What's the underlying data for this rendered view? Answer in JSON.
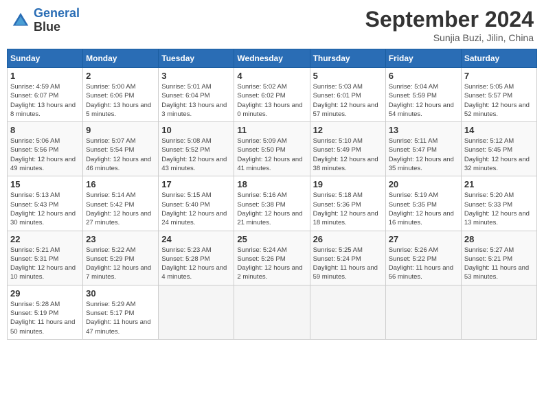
{
  "header": {
    "logo_line1": "General",
    "logo_line2": "Blue",
    "month": "September 2024",
    "location": "Sunjia Buzi, Jilin, China"
  },
  "weekdays": [
    "Sunday",
    "Monday",
    "Tuesday",
    "Wednesday",
    "Thursday",
    "Friday",
    "Saturday"
  ],
  "weeks": [
    [
      {
        "day": "1",
        "sunrise": "Sunrise: 4:59 AM",
        "sunset": "Sunset: 6:07 PM",
        "daylight": "Daylight: 13 hours and 8 minutes."
      },
      {
        "day": "2",
        "sunrise": "Sunrise: 5:00 AM",
        "sunset": "Sunset: 6:06 PM",
        "daylight": "Daylight: 13 hours and 5 minutes."
      },
      {
        "day": "3",
        "sunrise": "Sunrise: 5:01 AM",
        "sunset": "Sunset: 6:04 PM",
        "daylight": "Daylight: 13 hours and 3 minutes."
      },
      {
        "day": "4",
        "sunrise": "Sunrise: 5:02 AM",
        "sunset": "Sunset: 6:02 PM",
        "daylight": "Daylight: 13 hours and 0 minutes."
      },
      {
        "day": "5",
        "sunrise": "Sunrise: 5:03 AM",
        "sunset": "Sunset: 6:01 PM",
        "daylight": "Daylight: 12 hours and 57 minutes."
      },
      {
        "day": "6",
        "sunrise": "Sunrise: 5:04 AM",
        "sunset": "Sunset: 5:59 PM",
        "daylight": "Daylight: 12 hours and 54 minutes."
      },
      {
        "day": "7",
        "sunrise": "Sunrise: 5:05 AM",
        "sunset": "Sunset: 5:57 PM",
        "daylight": "Daylight: 12 hours and 52 minutes."
      }
    ],
    [
      {
        "day": "8",
        "sunrise": "Sunrise: 5:06 AM",
        "sunset": "Sunset: 5:56 PM",
        "daylight": "Daylight: 12 hours and 49 minutes."
      },
      {
        "day": "9",
        "sunrise": "Sunrise: 5:07 AM",
        "sunset": "Sunset: 5:54 PM",
        "daylight": "Daylight: 12 hours and 46 minutes."
      },
      {
        "day": "10",
        "sunrise": "Sunrise: 5:08 AM",
        "sunset": "Sunset: 5:52 PM",
        "daylight": "Daylight: 12 hours and 43 minutes."
      },
      {
        "day": "11",
        "sunrise": "Sunrise: 5:09 AM",
        "sunset": "Sunset: 5:50 PM",
        "daylight": "Daylight: 12 hours and 41 minutes."
      },
      {
        "day": "12",
        "sunrise": "Sunrise: 5:10 AM",
        "sunset": "Sunset: 5:49 PM",
        "daylight": "Daylight: 12 hours and 38 minutes."
      },
      {
        "day": "13",
        "sunrise": "Sunrise: 5:11 AM",
        "sunset": "Sunset: 5:47 PM",
        "daylight": "Daylight: 12 hours and 35 minutes."
      },
      {
        "day": "14",
        "sunrise": "Sunrise: 5:12 AM",
        "sunset": "Sunset: 5:45 PM",
        "daylight": "Daylight: 12 hours and 32 minutes."
      }
    ],
    [
      {
        "day": "15",
        "sunrise": "Sunrise: 5:13 AM",
        "sunset": "Sunset: 5:43 PM",
        "daylight": "Daylight: 12 hours and 30 minutes."
      },
      {
        "day": "16",
        "sunrise": "Sunrise: 5:14 AM",
        "sunset": "Sunset: 5:42 PM",
        "daylight": "Daylight: 12 hours and 27 minutes."
      },
      {
        "day": "17",
        "sunrise": "Sunrise: 5:15 AM",
        "sunset": "Sunset: 5:40 PM",
        "daylight": "Daylight: 12 hours and 24 minutes."
      },
      {
        "day": "18",
        "sunrise": "Sunrise: 5:16 AM",
        "sunset": "Sunset: 5:38 PM",
        "daylight": "Daylight: 12 hours and 21 minutes."
      },
      {
        "day": "19",
        "sunrise": "Sunrise: 5:18 AM",
        "sunset": "Sunset: 5:36 PM",
        "daylight": "Daylight: 12 hours and 18 minutes."
      },
      {
        "day": "20",
        "sunrise": "Sunrise: 5:19 AM",
        "sunset": "Sunset: 5:35 PM",
        "daylight": "Daylight: 12 hours and 16 minutes."
      },
      {
        "day": "21",
        "sunrise": "Sunrise: 5:20 AM",
        "sunset": "Sunset: 5:33 PM",
        "daylight": "Daylight: 12 hours and 13 minutes."
      }
    ],
    [
      {
        "day": "22",
        "sunrise": "Sunrise: 5:21 AM",
        "sunset": "Sunset: 5:31 PM",
        "daylight": "Daylight: 12 hours and 10 minutes."
      },
      {
        "day": "23",
        "sunrise": "Sunrise: 5:22 AM",
        "sunset": "Sunset: 5:29 PM",
        "daylight": "Daylight: 12 hours and 7 minutes."
      },
      {
        "day": "24",
        "sunrise": "Sunrise: 5:23 AM",
        "sunset": "Sunset: 5:28 PM",
        "daylight": "Daylight: 12 hours and 4 minutes."
      },
      {
        "day": "25",
        "sunrise": "Sunrise: 5:24 AM",
        "sunset": "Sunset: 5:26 PM",
        "daylight": "Daylight: 12 hours and 2 minutes."
      },
      {
        "day": "26",
        "sunrise": "Sunrise: 5:25 AM",
        "sunset": "Sunset: 5:24 PM",
        "daylight": "Daylight: 11 hours and 59 minutes."
      },
      {
        "day": "27",
        "sunrise": "Sunrise: 5:26 AM",
        "sunset": "Sunset: 5:22 PM",
        "daylight": "Daylight: 11 hours and 56 minutes."
      },
      {
        "day": "28",
        "sunrise": "Sunrise: 5:27 AM",
        "sunset": "Sunset: 5:21 PM",
        "daylight": "Daylight: 11 hours and 53 minutes."
      }
    ],
    [
      {
        "day": "29",
        "sunrise": "Sunrise: 5:28 AM",
        "sunset": "Sunset: 5:19 PM",
        "daylight": "Daylight: 11 hours and 50 minutes."
      },
      {
        "day": "30",
        "sunrise": "Sunrise: 5:29 AM",
        "sunset": "Sunset: 5:17 PM",
        "daylight": "Daylight: 11 hours and 47 minutes."
      },
      null,
      null,
      null,
      null,
      null
    ]
  ]
}
